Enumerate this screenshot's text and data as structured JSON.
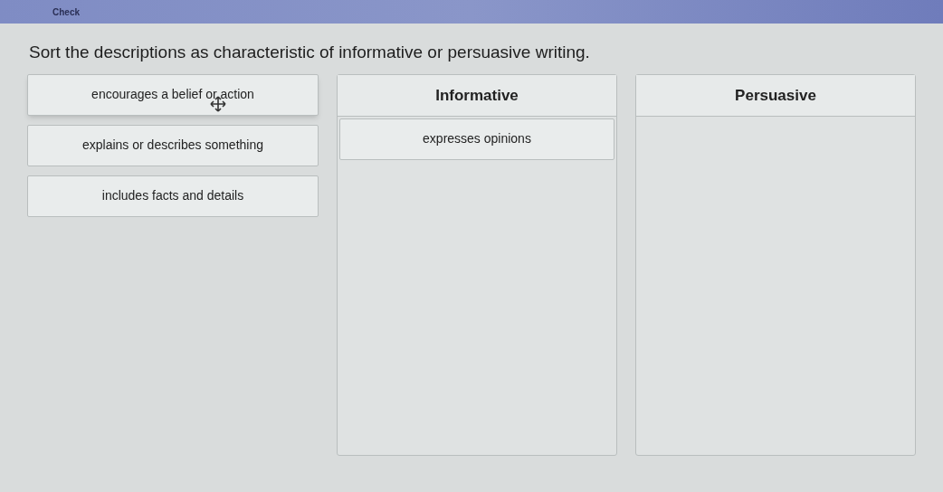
{
  "toolbar": {
    "check_button": "Check"
  },
  "instruction": "Sort the descriptions as characteristic of informative or persuasive writing.",
  "cards": [
    {
      "text": "encourages a belief or action",
      "grabbed": true
    },
    {
      "text": "explains or describes something",
      "grabbed": false
    },
    {
      "text": "includes facts and details",
      "grabbed": false
    }
  ],
  "columns": [
    {
      "heading": "Informative",
      "cards": [
        "expresses opinions"
      ]
    },
    {
      "heading": "Persuasive"
    }
  ]
}
